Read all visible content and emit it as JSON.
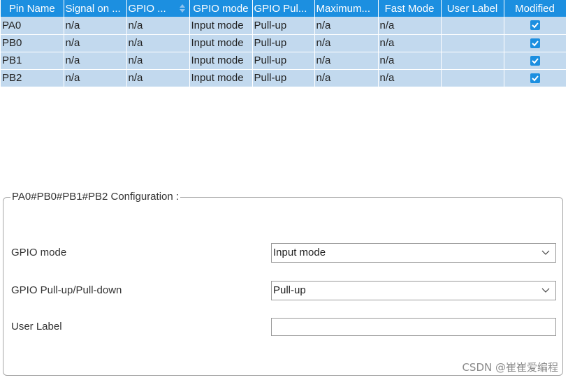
{
  "table": {
    "columns": [
      {
        "label": "Pin Name"
      },
      {
        "label": "Signal on ..."
      },
      {
        "label": "GPIO ..."
      },
      {
        "label": "GPIO mode"
      },
      {
        "label": "GPIO Pul..."
      },
      {
        "label": "Maximum..."
      },
      {
        "label": "Fast Mode"
      },
      {
        "label": "User Label"
      },
      {
        "label": "Modified"
      }
    ],
    "rows": [
      {
        "pin": "PA0",
        "signal": "n/a",
        "gpio": "n/a",
        "mode": "Input mode",
        "pull": "Pull-up",
        "max": "n/a",
        "fast": "n/a",
        "label": "",
        "modified": true
      },
      {
        "pin": "PB0",
        "signal": "n/a",
        "gpio": "n/a",
        "mode": "Input mode",
        "pull": "Pull-up",
        "max": "n/a",
        "fast": "n/a",
        "label": "",
        "modified": true
      },
      {
        "pin": "PB1",
        "signal": "n/a",
        "gpio": "n/a",
        "mode": "Input mode",
        "pull": "Pull-up",
        "max": "n/a",
        "fast": "n/a",
        "label": "",
        "modified": true
      },
      {
        "pin": "PB2",
        "signal": "n/a",
        "gpio": "n/a",
        "mode": "Input mode",
        "pull": "Pull-up",
        "max": "n/a",
        "fast": "n/a",
        "label": "",
        "modified": true
      }
    ]
  },
  "config": {
    "title": "PA0#PB0#PB1#PB2 Configuration :",
    "gpio_mode_label": "GPIO mode",
    "gpio_mode_value": "Input mode",
    "pull_label": "GPIO Pull-up/Pull-down",
    "pull_value": "Pull-up",
    "user_label_label": "User Label",
    "user_label_value": ""
  },
  "watermark": "CSDN @崔崔爱编程",
  "colors": {
    "header": "#1c8fe0",
    "row": "#c2d9ee",
    "checkbox": "#1c8fe0"
  }
}
